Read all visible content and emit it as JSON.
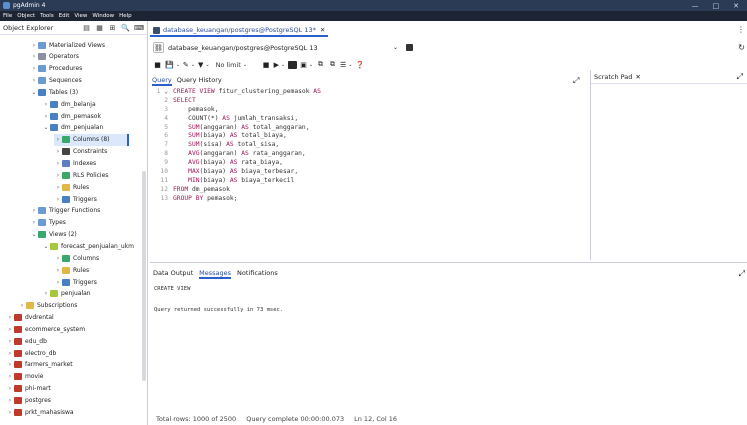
{
  "window": {
    "title": "pgAdmin 4",
    "controls": [
      "—",
      "□",
      "✕"
    ]
  },
  "menu": [
    "File",
    "Object",
    "Tools",
    "Edit",
    "View",
    "Window",
    "Help"
  ],
  "explorer": {
    "title": "Object Explorer",
    "tools": [
      "▤",
      "▦",
      "⊞",
      "🔍",
      "⌨"
    ],
    "nodes": [
      {
        "arrow": "›",
        "label": "Materialized Views",
        "icon_color": "#6b9bd1",
        "icon": "materialized-views-icon"
      },
      {
        "arrow": "›",
        "label": "Operators",
        "icon_color": "#8a8fa3",
        "icon": "operators-icon"
      },
      {
        "arrow": "›",
        "label": "Procedures",
        "icon_color": "#6b9bd1",
        "icon": "procedures-icon"
      },
      {
        "arrow": "›",
        "label": "Sequences",
        "icon_color": "#6b9bd1",
        "icon": "sequences-icon"
      },
      {
        "arrow": "⌄",
        "label": "Tables (3)",
        "icon_color": "#4a7fc4",
        "icon": "tables-icon"
      },
      {
        "arrow": "›",
        "label": "dm_belanja",
        "icon_color": "#4a7fc4",
        "icon": "table-icon"
      },
      {
        "arrow": "›",
        "label": "dm_pemasok",
        "icon_color": "#4a7fc4",
        "icon": "table-icon"
      },
      {
        "arrow": "⌄",
        "label": "dm_penjualan",
        "icon_color": "#4a7fc4",
        "icon": "table-icon"
      },
      {
        "arrow": "›",
        "label": "Columns (8)",
        "icon_color": "#3aa86b",
        "icon": "columns-icon"
      },
      {
        "arrow": "›",
        "label": "Constraints",
        "icon_color": "#444444",
        "icon": "constraints-icon"
      },
      {
        "arrow": "›",
        "label": "Indexes",
        "icon_color": "#5a7fc4",
        "icon": "indexes-icon"
      },
      {
        "arrow": "›",
        "label": "RLS Policies",
        "icon_color": "#3aa86b",
        "icon": "rls-policies-icon"
      },
      {
        "arrow": "›",
        "label": "Rules",
        "icon_color": "#e0b84a",
        "icon": "rules-icon"
      },
      {
        "arrow": "›",
        "label": "Triggers",
        "icon_color": "#4a7fc4",
        "icon": "triggers-icon"
      },
      {
        "arrow": "›",
        "label": "Trigger Functions",
        "icon_color": "#6b9bd1",
        "icon": "trigger-functions-icon"
      },
      {
        "arrow": "›",
        "label": "Types",
        "icon_color": "#6b9bd1",
        "icon": "types-icon"
      },
      {
        "arrow": "⌄",
        "label": "Views (2)",
        "icon_color": "#3aa86b",
        "icon": "views-icon"
      },
      {
        "arrow": "⌄",
        "label": "forecast_penjualan_ukm",
        "icon_color": "#a6c83c",
        "icon": "view-icon"
      },
      {
        "arrow": "›",
        "label": "Columns",
        "icon_color": "#3aa86b",
        "icon": "columns-icon"
      },
      {
        "arrow": "›",
        "label": "Rules",
        "icon_color": "#e0b84a",
        "icon": "rules-icon"
      },
      {
        "arrow": "›",
        "label": "Triggers",
        "icon_color": "#4a7fc4",
        "icon": "triggers-icon"
      },
      {
        "arrow": "›",
        "label": "penjualan",
        "icon_color": "#a6c83c",
        "icon": "view-icon"
      },
      {
        "arrow": "›",
        "label": "Subscriptions",
        "icon_color": "#e0b84a",
        "icon": "subscriptions-icon"
      },
      {
        "arrow": "›",
        "label": "dvdrental",
        "icon_color": "#c0392b",
        "icon": "database-icon"
      },
      {
        "arrow": "›",
        "label": "ecommerce_system",
        "icon_color": "#c0392b",
        "icon": "database-icon"
      },
      {
        "arrow": "›",
        "label": "edu_db",
        "icon_color": "#c0392b",
        "icon": "database-icon"
      },
      {
        "arrow": "›",
        "label": "electro_db",
        "icon_color": "#c0392b",
        "icon": "database-icon"
      },
      {
        "arrow": "›",
        "label": "farmers_market",
        "icon_color": "#c0392b",
        "icon": "database-icon"
      },
      {
        "arrow": "›",
        "label": "movie",
        "icon_color": "#c0392b",
        "icon": "database-icon"
      },
      {
        "arrow": "›",
        "label": "phi-mart",
        "icon_color": "#c0392b",
        "icon": "database-icon"
      },
      {
        "arrow": "›",
        "label": "postgres",
        "icon_color": "#c0392b",
        "icon": "database-icon"
      },
      {
        "arrow": "›",
        "label": "prkt_mahasiswa",
        "icon_color": "#c0392b",
        "icon": "database-icon"
      }
    ]
  },
  "query_tab": {
    "label": "database_keuangan/postgres@PostgreSQL 13*",
    "close": "✕"
  },
  "connection": {
    "label": "database_keuangan/postgres@PostgreSQL 13"
  },
  "toolbar": {
    "limit_label": "No limit"
  },
  "editor_tabs": [
    "Query",
    "Query History"
  ],
  "scratch_pad": {
    "label": "Scratch Pad",
    "close": "✕"
  },
  "code_lines": [
    {
      "num": "1",
      "marker": "⌄",
      "parts": [
        [
          "kw",
          "CREATE VIEW "
        ],
        [
          "plain",
          "fitur_clustering_pemasok "
        ],
        [
          "kw",
          "AS"
        ]
      ]
    },
    {
      "num": "2",
      "marker": "",
      "parts": [
        [
          "kw",
          "SELECT"
        ]
      ]
    },
    {
      "num": "3",
      "marker": "",
      "parts": [
        [
          "plain",
          "    pemasok,"
        ]
      ]
    },
    {
      "num": "4",
      "marker": "",
      "parts": [
        [
          "plain",
          "    COUNT(*) "
        ],
        [
          "kw",
          "AS "
        ],
        [
          "plain",
          "jumlah_transaksi,"
        ]
      ]
    },
    {
      "num": "5",
      "marker": "",
      "parts": [
        [
          "kw",
          "    SUM"
        ],
        [
          "plain",
          "(anggaran) "
        ],
        [
          "kw",
          "AS "
        ],
        [
          "plain",
          "total_anggaran,"
        ]
      ]
    },
    {
      "num": "6",
      "marker": "",
      "parts": [
        [
          "kw",
          "    SUM"
        ],
        [
          "plain",
          "(biaya) "
        ],
        [
          "kw",
          "AS "
        ],
        [
          "plain",
          "total_biaya,"
        ]
      ]
    },
    {
      "num": "7",
      "marker": "",
      "parts": [
        [
          "kw",
          "    SUM"
        ],
        [
          "plain",
          "(sisa) "
        ],
        [
          "kw",
          "AS "
        ],
        [
          "plain",
          "total_sisa,"
        ]
      ]
    },
    {
      "num": "8",
      "marker": "",
      "parts": [
        [
          "kw",
          "    AVG"
        ],
        [
          "plain",
          "(anggaran) "
        ],
        [
          "kw",
          "AS "
        ],
        [
          "plain",
          "rata_anggaran,"
        ]
      ]
    },
    {
      "num": "9",
      "marker": "",
      "parts": [
        [
          "kw",
          "    AVG"
        ],
        [
          "plain",
          "(biaya) "
        ],
        [
          "kw",
          "AS "
        ],
        [
          "plain",
          "rata_biaya,"
        ]
      ]
    },
    {
      "num": "10",
      "marker": "",
      "parts": [
        [
          "kw",
          "    MAX"
        ],
        [
          "plain",
          "(biaya) "
        ],
        [
          "kw",
          "AS "
        ],
        [
          "plain",
          "biaya_terbesar,"
        ]
      ]
    },
    {
      "num": "11",
      "marker": "",
      "parts": [
        [
          "kw",
          "    MIN"
        ],
        [
          "plain",
          "(biaya) "
        ],
        [
          "kw",
          "AS "
        ],
        [
          "plain",
          "biaya_terkecil"
        ]
      ]
    },
    {
      "num": "12",
      "marker": "",
      "parts": [
        [
          "kw",
          "FROM "
        ],
        [
          "plain",
          "dm_pemasok"
        ]
      ]
    },
    {
      "num": "13",
      "marker": "",
      "parts": [
        [
          "kw",
          "GROUP BY "
        ],
        [
          "plain",
          "pemasok;"
        ]
      ]
    }
  ],
  "output_tabs": [
    "Data Output",
    "Messages",
    "Notifications"
  ],
  "messages": [
    "CREATE VIEW",
    "Query returned successfully in 73 msec."
  ],
  "status": {
    "rows": "Total rows: 1000 of 2500",
    "complete": "Query complete 00:00:00.073",
    "position": "Ln 12, Col 16"
  }
}
